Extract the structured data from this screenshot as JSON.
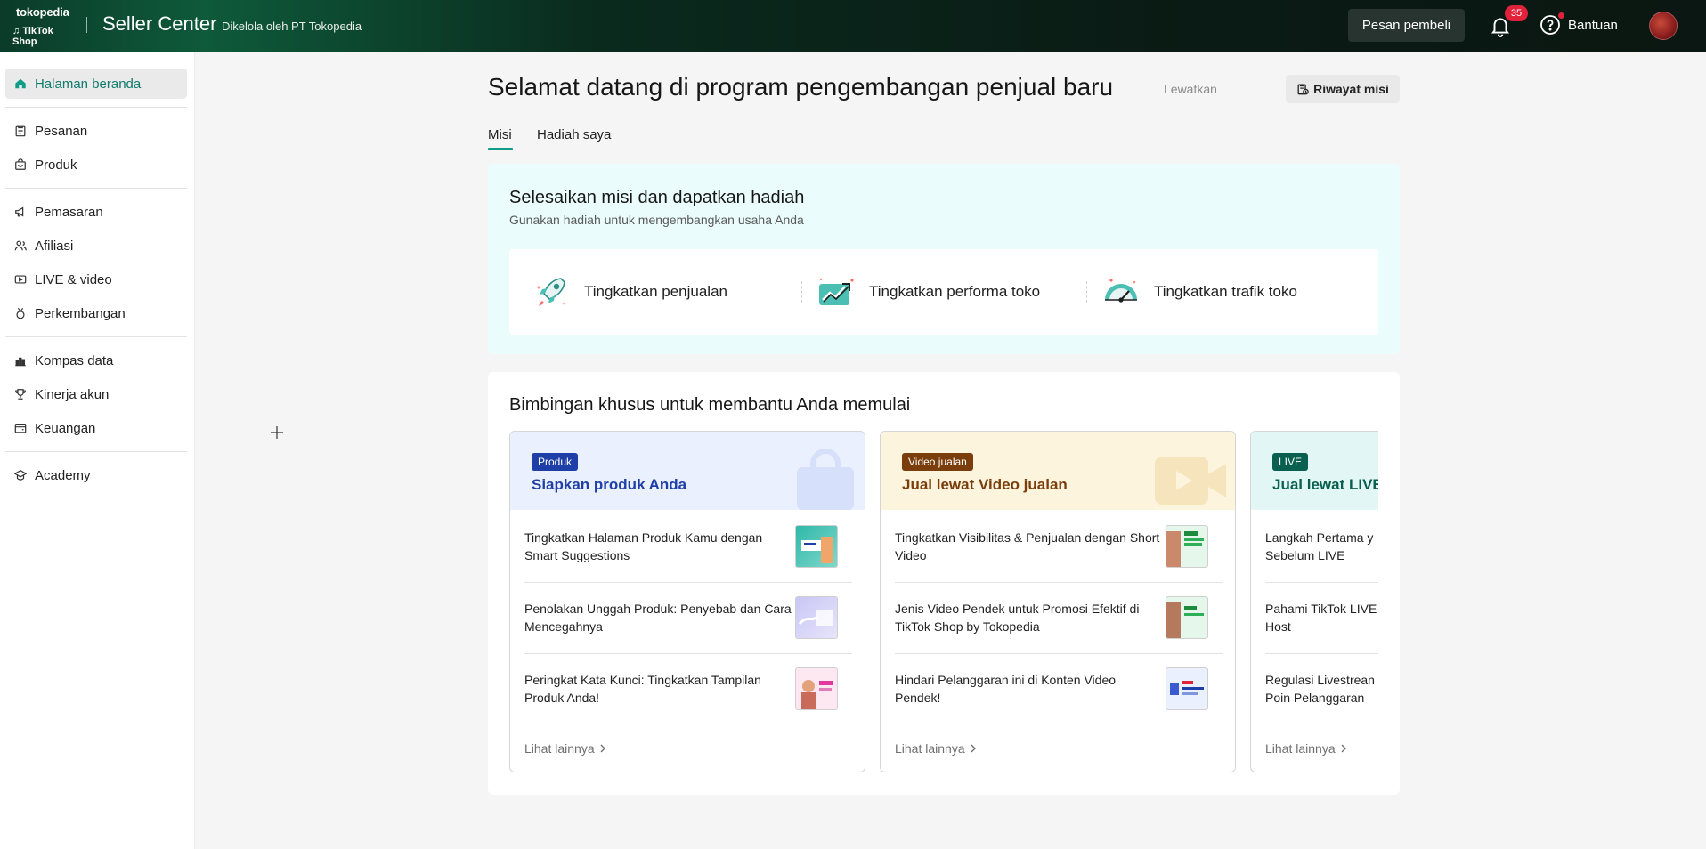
{
  "header": {
    "logo_top": "tokopedia",
    "logo_bottom": "TikTok Shop",
    "brand": "Seller Center",
    "managed_by": "Dikelola oleh PT Tokopedia",
    "buyer_messages": "Pesan pembeli",
    "notification_count": "35",
    "help": "Bantuan"
  },
  "sidebar": {
    "items": [
      {
        "label": "Halaman beranda",
        "icon": "home-icon",
        "active": true
      },
      {
        "label": "Pesanan",
        "icon": "orders-icon"
      },
      {
        "label": "Produk",
        "icon": "product-icon"
      },
      {
        "label": "Pemasaran",
        "icon": "megaphone-icon"
      },
      {
        "label": "Afiliasi",
        "icon": "affiliate-icon"
      },
      {
        "label": "LIVE & video",
        "icon": "live-video-icon"
      },
      {
        "label": "Perkembangan",
        "icon": "growth-icon"
      },
      {
        "label": "Kompas data",
        "icon": "data-compass-icon"
      },
      {
        "label": "Kinerja akun",
        "icon": "trophy-icon"
      },
      {
        "label": "Keuangan",
        "icon": "wallet-icon"
      },
      {
        "label": "Academy",
        "icon": "academy-icon"
      }
    ]
  },
  "main": {
    "title": "Selamat datang di program pengembangan penjual baru",
    "skip": "Lewatkan",
    "history": "Riwayat misi",
    "tabs": [
      {
        "label": "Misi",
        "active": true
      },
      {
        "label": "Hadiah saya"
      }
    ],
    "missions": {
      "title": "Selesaikan misi dan dapatkan hadiah",
      "subtitle": "Gunakan hadiah untuk mengembangkan usaha Anda",
      "items": [
        {
          "label": "Tingkatkan penjualan",
          "icon": "rocket-icon"
        },
        {
          "label": "Tingkatkan performa toko",
          "icon": "trend-chart-icon"
        },
        {
          "label": "Tingkatkan trafik toko",
          "icon": "speedometer-icon"
        }
      ]
    },
    "guides": {
      "title": "Bimbingan khusus untuk membantu Anda memulai",
      "cards": [
        {
          "tag": "Produk",
          "title": "Siapkan produk Anda",
          "rows": [
            "Tingkatkan Halaman Produk Kamu dengan Smart Suggestions",
            "Penolakan Unggah Produk: Penyebab dan Cara Mencegahnya",
            "Peringkat Kata Kunci: Tingkatkan Tampilan Produk Anda!"
          ],
          "more": "Lihat lainnya"
        },
        {
          "tag": "Video jualan",
          "title": "Jual lewat Video jualan",
          "rows": [
            "Tingkatkan Visibilitas & Penjualan dengan Short Video",
            "Jenis Video Pendek untuk Promosi Efektif di TikTok Shop by Tokopedia",
            "Hindari Pelanggaran ini di Konten Video Pendek!"
          ],
          "more": "Lihat lainnya"
        },
        {
          "tag": "LIVE",
          "title": "Jual lewat LIVE",
          "rows": [
            "Langkah Pertama y Sebelum LIVE",
            "Pahami TikTok LIVE Host",
            "Regulasi Livestrean Poin Pelanggaran"
          ],
          "more": "Lihat lainnya"
        }
      ]
    }
  },
  "colors": {
    "accent": "#0f9d88",
    "active_nav_text": "#0f7b6c",
    "badge": "#e0223b",
    "produk_tag": "#1f3fa8",
    "video_tag": "#7a3e0c",
    "live_tag": "#0a6050"
  }
}
